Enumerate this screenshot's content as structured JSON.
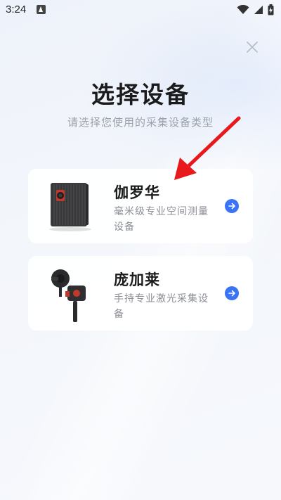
{
  "status_bar": {
    "time": "3:24",
    "icons": [
      "notification-a-icon",
      "wifi-icon",
      "signal-icon",
      "battery-charging-icon"
    ]
  },
  "header": {
    "title": "选择设备",
    "subtitle": "请选择您使用的采集设备类型",
    "close_icon": "close-icon"
  },
  "devices": [
    {
      "name": "伽罗华",
      "description": "毫米级专业空间测量设备",
      "icon": "arrow-right-circle-icon"
    },
    {
      "name": "庞加莱",
      "description": "手持专业激光采集设备",
      "icon": "arrow-right-circle-icon"
    }
  ],
  "annotation": {
    "arrow_color": "#e8191c"
  },
  "colors": {
    "accent": "#3b73f6",
    "annotation_arrow": "#e8191c"
  }
}
